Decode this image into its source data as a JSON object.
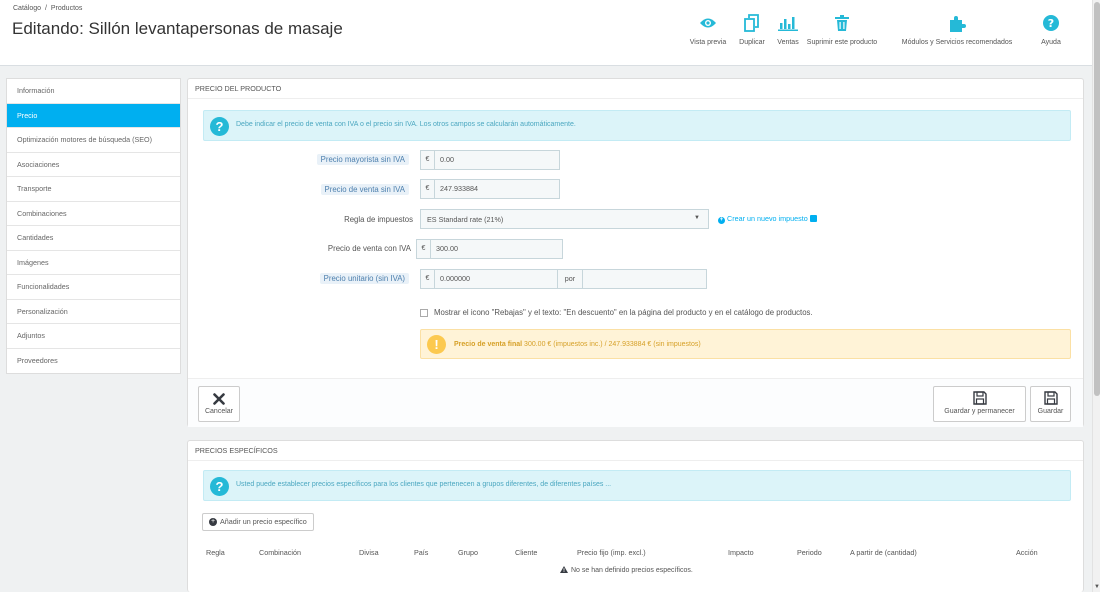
{
  "header": {
    "breadcrumb": [
      "Catálogo",
      "/",
      "Productos"
    ],
    "title": "Editando: Sillón levantapersonas de masaje",
    "toolbar": [
      {
        "label": "Vista previa",
        "icon": "eye-icon"
      },
      {
        "label": "Duplicar",
        "icon": "copy-icon"
      },
      {
        "label": "Ventas",
        "icon": "bar-chart-icon"
      },
      {
        "label": "Suprimir este producto",
        "icon": "trash-icon"
      },
      {
        "label": "Módulos y Servicios recomendados",
        "icon": "puzzle-icon"
      },
      {
        "label": "Ayuda",
        "icon": "help-icon"
      }
    ]
  },
  "sidebar": {
    "items": [
      {
        "label": "Información"
      },
      {
        "label": "Precio",
        "active": true
      },
      {
        "label": "Optimización motores de búsqueda (SEO)"
      },
      {
        "label": "Asociaciones"
      },
      {
        "label": "Transporte"
      },
      {
        "label": "Combinaciones"
      },
      {
        "label": "Cantidades"
      },
      {
        "label": "Imágenes"
      },
      {
        "label": "Funcionalidades"
      },
      {
        "label": "Personalización"
      },
      {
        "label": "Adjuntos"
      },
      {
        "label": "Proveedores"
      }
    ]
  },
  "price_panel": {
    "heading": "Precio del producto",
    "info": "Debe indicar el precio de venta con IVA o el precio sin IVA. Los otros campos se calcularán automáticamente.",
    "wholesale": {
      "label": "Precio mayorista sin IVA",
      "currency": "€",
      "value": "0.00"
    },
    "retail_excl": {
      "label": "Precio de venta sin IVA",
      "currency": "€",
      "value": "247.933884"
    },
    "tax_rule": {
      "label": "Regla de impuestos",
      "value": "ES Standard rate (21%)"
    },
    "create_tax": "Crear un nuevo impuesto",
    "retail_incl": {
      "label": "Precio de venta con IVA",
      "currency": "€",
      "value": "300.00"
    },
    "unit_price": {
      "label": "Precio unitario (sin IVA)",
      "currency": "€",
      "value": "0.000000",
      "per": "por",
      "unit_value": ""
    },
    "on_sale": "Mostrar el icono \"Rebajas\" y el texto: \"En descuento\" en la página del producto y en el catálogo de productos.",
    "final_label": "Precio de venta final",
    "final_text": "300.00 € (impuestos inc.) / 247.933884 € (sin impuestos)",
    "cancel": "Cancelar",
    "save_stay": "Guardar y permanecer",
    "save": "Guardar"
  },
  "specific_panel": {
    "heading": "Precios específicos",
    "info": "Usted puede establecer precios específicos para los clientes que pertenecen a grupos diferentes, de diferentes países ...",
    "add_button": "Añadir un precio específico",
    "columns": [
      "Regla",
      "Combinación",
      "Divisa",
      "País",
      "Grupo",
      "Cliente",
      "Precio fijo (imp. excl.)",
      "Impacto",
      "Periodo",
      "A partir de (cantidad)",
      "Acción"
    ],
    "empty": "No se han definido precios específicos."
  },
  "colors": {
    "accent": "#00aff0",
    "toolbar_icon": "#25b9d7",
    "info_bg": "#dcf4f9",
    "warning_bg": "#fff3d7"
  }
}
